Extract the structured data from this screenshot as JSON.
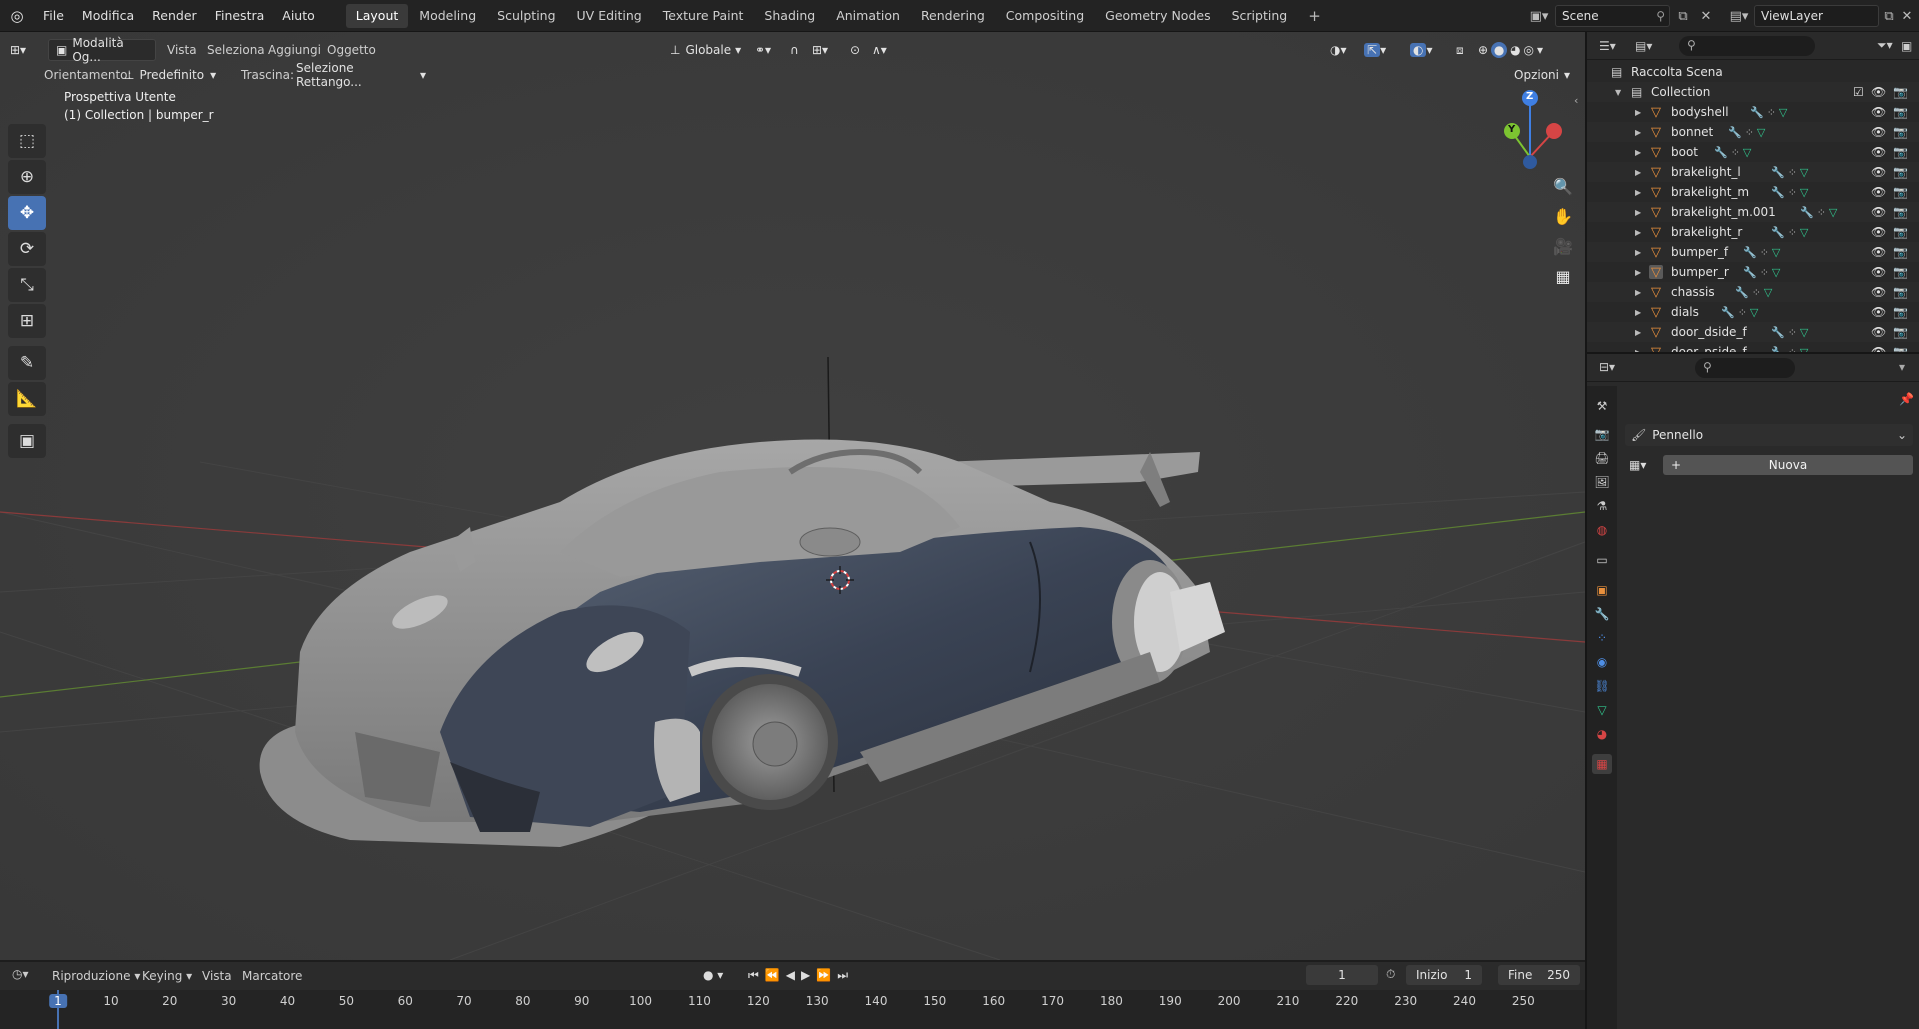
{
  "topbar": {
    "menu": [
      "File",
      "Modifica",
      "Render",
      "Finestra",
      "Aiuto"
    ],
    "workspaces": [
      "Layout",
      "Modeling",
      "Sculpting",
      "UV Editing",
      "Texture Paint",
      "Shading",
      "Animation",
      "Rendering",
      "Compositing",
      "Geometry Nodes",
      "Scripting"
    ],
    "active_workspace": "Layout",
    "scene": "Scene",
    "view_layer": "ViewLayer"
  },
  "viewport": {
    "mode": "Modalità Og...",
    "menu": [
      "Vista",
      "Seleziona",
      "Aggiungi",
      "Oggetto"
    ],
    "orientation_label": "Orientamento:",
    "orientation_value": "Predefinito",
    "drag_label": "Trascina:",
    "drag_value": "Selezione Rettango...",
    "transform_orientation": "Globale",
    "options": "Opzioni",
    "view_name": "Prospettiva Utente",
    "collection_info": "(1) Collection | bumper_r",
    "gizmo": {
      "z": "Z",
      "y": "Y"
    }
  },
  "outliner": {
    "root": "Raccolta Scena",
    "collection": "Collection",
    "items": [
      "bodyshell",
      "bonnet",
      "boot",
      "brakelight_l",
      "brakelight_m",
      "brakelight_m.001",
      "brakelight_r",
      "bumper_f",
      "bumper_r",
      "chassis",
      "dials",
      "door_dside_f",
      "door_pside_f"
    ],
    "selected": "bumper_r"
  },
  "properties": {
    "brush_label": "Pennello",
    "new_button": "Nuova"
  },
  "timeline": {
    "menu": [
      "Riproduzione",
      "Keying",
      "Vista",
      "Marcatore"
    ],
    "current_frame": "1",
    "start_label": "Inizio",
    "start_value": "1",
    "end_label": "Fine",
    "end_value": "250",
    "ticks": [
      "1",
      "10",
      "20",
      "30",
      "40",
      "50",
      "60",
      "70",
      "80",
      "90",
      "100",
      "110",
      "120",
      "130",
      "140",
      "150",
      "160",
      "170",
      "180",
      "190",
      "200",
      "210",
      "220",
      "230",
      "240",
      "250"
    ]
  },
  "colors": {
    "accent": "#4772b3",
    "object_orange": "#e9903d",
    "mesh_green": "#31c48d",
    "x_axis": "#d64545",
    "y_axis": "#7cc431",
    "z_axis": "#3f7fe3"
  }
}
